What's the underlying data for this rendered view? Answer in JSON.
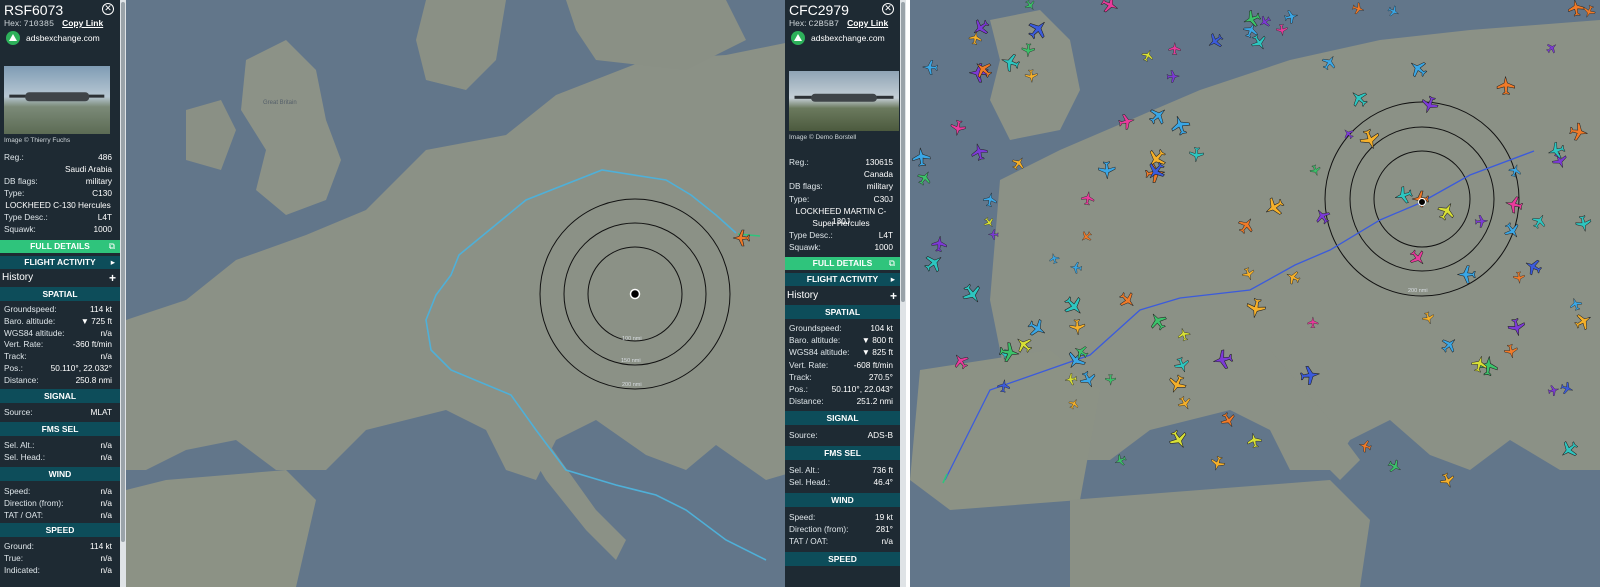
{
  "left": {
    "callsign": "RSF6073",
    "hex_label": "Hex:",
    "hex": "710385",
    "copy_link": "Copy Link",
    "adsb_label": "adsbexchange.com",
    "image_credit": "Image © Thierry Fuchs",
    "info": [
      {
        "k": "Reg.:",
        "v": "486"
      },
      {
        "k": "",
        "v": "Saudi Arabia"
      },
      {
        "k": "DB flags:",
        "v": "military"
      },
      {
        "k": "Type:",
        "v": "C130"
      },
      {
        "k": "",
        "c": "LOCKHEED C-130 Hercules"
      },
      {
        "k": "Type Desc.:",
        "v": "L4T"
      },
      {
        "k": "Squawk:",
        "v": "1000"
      }
    ],
    "full_details": "FULL DETAILS",
    "flight_activity": "FLIGHT ACTIVITY",
    "history": "History",
    "sections": {
      "spatial": "SPATIAL",
      "signal": "SIGNAL",
      "fms": "FMS SEL",
      "wind": "WIND",
      "speed": "SPEED"
    },
    "spatial": [
      {
        "k": "Groundspeed:",
        "v": "114 kt"
      },
      {
        "k": "Baro. altitude:",
        "v": "▼ 725 ft"
      },
      {
        "k": "WGS84 altitude:",
        "v": "n/a"
      },
      {
        "k": "Vert. Rate:",
        "v": "-360 ft/min"
      },
      {
        "k": "Track:",
        "v": "n/a"
      },
      {
        "k": "Pos.:",
        "v": "50.110°, 22.032°"
      },
      {
        "k": "Distance:",
        "v": "250.8 nmi"
      }
    ],
    "signal": [
      {
        "k": "Source:",
        "v": "MLAT"
      }
    ],
    "fms": [
      {
        "k": "Sel. Alt.:",
        "v": "n/a"
      },
      {
        "k": "Sel. Head.:",
        "v": "n/a"
      }
    ],
    "wind": [
      {
        "k": "Speed:",
        "v": "n/a"
      },
      {
        "k": "Direction (from):",
        "v": "n/a"
      },
      {
        "k": "TAT / OAT:",
        "v": "n/a"
      }
    ],
    "speed": [
      {
        "k": "Ground:",
        "v": "114 kt"
      },
      {
        "k": "True:",
        "v": "n/a"
      },
      {
        "k": "Indicated:",
        "v": "n/a"
      }
    ],
    "map": {
      "labels": [
        "Great Britain",
        "100 nmi",
        "150 nmi",
        "200 nmi"
      ]
    }
  },
  "right": {
    "callsign": "CFC2979",
    "hex_label": "Hex:",
    "hex": "C2B5B7",
    "copy_link": "Copy Link",
    "adsb_label": "adsbexchange.com",
    "image_credit": "Image © Demo Borstell",
    "info": [
      {
        "k": "Reg.:",
        "v": "130615"
      },
      {
        "k": "",
        "v": "Canada"
      },
      {
        "k": "DB flags:",
        "v": "military"
      },
      {
        "k": "Type:",
        "v": "C30J"
      },
      {
        "k": "",
        "c": "LOCKHEED MARTIN C-130J"
      },
      {
        "k": "",
        "c": "Super Hercules"
      },
      {
        "k": "Type Desc.:",
        "v": "L4T"
      },
      {
        "k": "Squawk:",
        "v": "1000"
      }
    ],
    "full_details": "FULL DETAILS",
    "flight_activity": "FLIGHT ACTIVITY",
    "history": "History",
    "sections": {
      "spatial": "SPATIAL",
      "signal": "SIGNAL",
      "fms": "FMS SEL",
      "wind": "WIND",
      "speed": "SPEED"
    },
    "spatial": [
      {
        "k": "Groundspeed:",
        "v": "104 kt"
      },
      {
        "k": "Baro. altitude:",
        "v": "▼ 800 ft"
      },
      {
        "k": "WGS84 altitude:",
        "v": "▼ 825 ft"
      },
      {
        "k": "Vert. Rate:",
        "v": "-608 ft/min"
      },
      {
        "k": "Track:",
        "v": "270.5°"
      },
      {
        "k": "Pos.:",
        "v": "50.110°, 22.043°"
      },
      {
        "k": "Distance:",
        "v": "251.2 nmi"
      }
    ],
    "signal": [
      {
        "k": "Source:",
        "v": "ADS-B"
      }
    ],
    "fms": [
      {
        "k": "Sel. Alt.:",
        "v": "736 ft"
      },
      {
        "k": "Sel. Head.:",
        "v": "46.4°"
      }
    ],
    "wind": [
      {
        "k": "Speed:",
        "v": "19 kt"
      },
      {
        "k": "Direction (from):",
        "v": "281°"
      },
      {
        "k": "TAT / OAT:",
        "v": "n/a"
      }
    ],
    "speed": [],
    "map": {
      "labels": [
        "200 nmi"
      ]
    }
  },
  "colors": {
    "panel_bg": "#1e2a33",
    "accent_green": "#2fc47c",
    "section_teal": "#0d4d5a",
    "sea": "#64778a",
    "land": "#8b9186",
    "track_left": "#4fb0d8",
    "track_right": "#3b5bdc"
  }
}
